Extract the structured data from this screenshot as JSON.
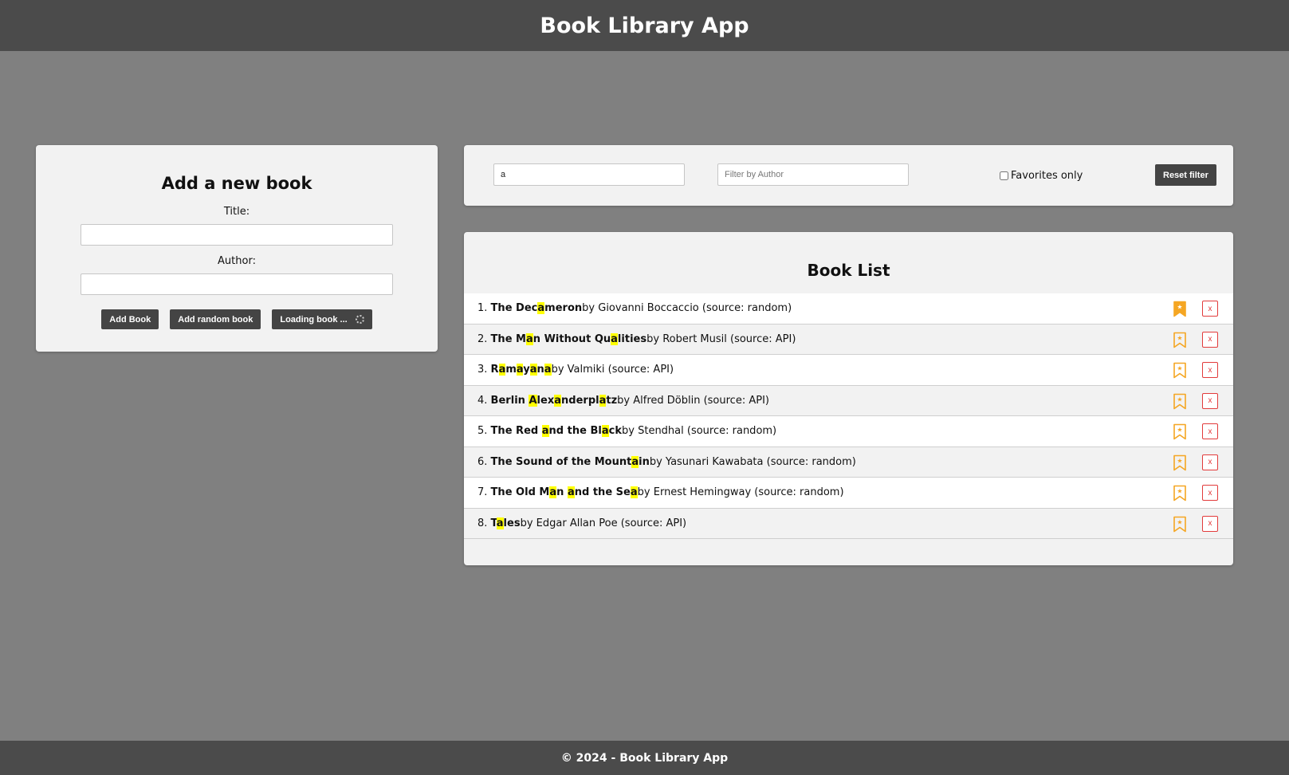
{
  "header": {
    "title": "Book Library App"
  },
  "add_form": {
    "heading": "Add a new book",
    "title_label": "Title:",
    "title_value": "",
    "author_label": "Author:",
    "author_value": "",
    "add_button": "Add Book",
    "random_button": "Add random book",
    "loading_button": "Loading book ..."
  },
  "filters": {
    "title_value": "a",
    "author_placeholder": "Filter by Author",
    "author_value": "",
    "favorites_label": "Favorites only",
    "favorites_checked": false,
    "reset_button": "Reset filter"
  },
  "book_list": {
    "heading": "Book List",
    "delete_label": "x",
    "accent_color": "#f5a623",
    "delete_color": "#e23b3b",
    "highlight_color": "#ffff00",
    "books": [
      {
        "num": "1.",
        "title": "The Decameron",
        "rest": " by Giovanni Boccaccio (source: random)",
        "favorite": true
      },
      {
        "num": "2.",
        "title": "The Man Without Qualities",
        "rest": " by Robert Musil (source: API)",
        "favorite": false
      },
      {
        "num": "3.",
        "title": "Ramayana",
        "rest": " by Valmiki (source: API)",
        "favorite": false
      },
      {
        "num": "4.",
        "title": "Berlin Alexanderplatz",
        "rest": " by Alfred Döblin (source: API)",
        "favorite": false
      },
      {
        "num": "5.",
        "title": "The Red and the Black",
        "rest": " by Stendhal (source: random)",
        "favorite": false
      },
      {
        "num": "6.",
        "title": "The Sound of the Mountain",
        "rest": " by Yasunari Kawabata (source: random)",
        "favorite": false
      },
      {
        "num": "7.",
        "title": "The Old Man and the Sea",
        "rest": " by Ernest Hemingway (source: random)",
        "favorite": false
      },
      {
        "num": "8.",
        "title": "Tales",
        "rest": " by Edgar Allan Poe (source: API)",
        "favorite": false
      }
    ]
  },
  "footer": {
    "text": "© 2024 - Book Library App"
  }
}
